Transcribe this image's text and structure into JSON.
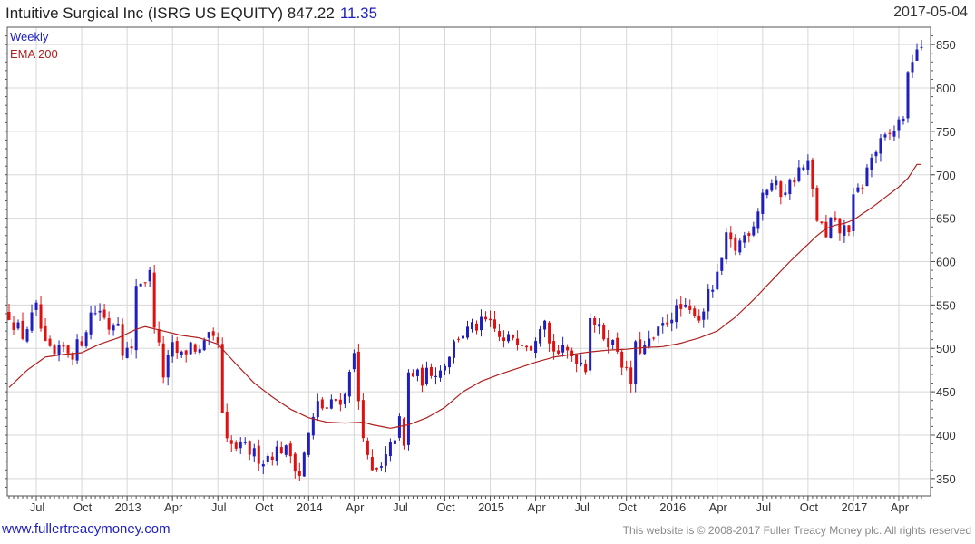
{
  "header": {
    "title": "Intuitive Surgical Inc (ISRG US EQUITY) 847.22",
    "change": "11.35",
    "date": "2017-05-04"
  },
  "footer": {
    "left": "www.fullertreacymoney.com",
    "right": "This website is © 2008-2017 Fuller Treacy Money plc. All rights reserved"
  },
  "colors": {
    "up": "#1f1fbf",
    "down": "#e01010",
    "ema": "#b02020",
    "grid": "#d8d8d8",
    "axis": "#555555"
  },
  "chart_data": {
    "type": "candlestick",
    "legend": [
      "Weekly",
      "EMA 200"
    ],
    "ylim": [
      330,
      870
    ],
    "yticks": [
      350,
      400,
      450,
      500,
      550,
      600,
      650,
      700,
      750,
      800,
      850
    ],
    "xlim": [
      0,
      201
    ],
    "xticks": [
      {
        "label": "Jul",
        "x": 6
      },
      {
        "label": "Oct",
        "x": 16
      },
      {
        "label": "2013",
        "x": 26
      },
      {
        "label": "Apr",
        "x": 36
      },
      {
        "label": "Jul",
        "x": 46
      },
      {
        "label": "Oct",
        "x": 56
      },
      {
        "label": "2014",
        "x": 66
      },
      {
        "label": "Apr",
        "x": 76
      },
      {
        "label": "Jul",
        "x": 86
      },
      {
        "label": "Oct",
        "x": 96
      },
      {
        "label": "2015",
        "x": 106
      },
      {
        "label": "Apr",
        "x": 116
      },
      {
        "label": "Jul",
        "x": 126
      },
      {
        "label": "Oct",
        "x": 136
      },
      {
        "label": "2016",
        "x": 146
      },
      {
        "label": "Apr",
        "x": 156
      },
      {
        "label": "Jul",
        "x": 166
      },
      {
        "label": "Oct",
        "x": 176
      },
      {
        "label": "2017",
        "x": 186
      },
      {
        "label": "Apr",
        "x": 196
      }
    ],
    "price_path": [
      [
        0,
        540
      ],
      [
        1,
        530
      ],
      [
        3,
        515
      ],
      [
        6,
        545
      ],
      [
        8,
        500
      ],
      [
        10,
        490
      ],
      [
        12,
        500
      ],
      [
        14,
        495
      ],
      [
        16,
        510
      ],
      [
        18,
        540
      ],
      [
        20,
        545
      ],
      [
        22,
        525
      ],
      [
        24,
        535
      ],
      [
        25,
        500
      ],
      [
        27,
        495
      ],
      [
        28,
        575
      ],
      [
        30,
        580
      ],
      [
        31,
        585
      ],
      [
        32,
        530
      ],
      [
        34,
        470
      ],
      [
        36,
        500
      ],
      [
        38,
        490
      ],
      [
        40,
        505
      ],
      [
        42,
        495
      ],
      [
        44,
        510
      ],
      [
        46,
        505
      ],
      [
        47,
        420
      ],
      [
        48,
        390
      ],
      [
        50,
        385
      ],
      [
        52,
        385
      ],
      [
        54,
        378
      ],
      [
        56,
        372
      ],
      [
        58,
        380
      ],
      [
        60,
        385
      ],
      [
        62,
        378
      ],
      [
        64,
        355
      ],
      [
        66,
        400
      ],
      [
        68,
        435
      ],
      [
        70,
        430
      ],
      [
        72,
        440
      ],
      [
        74,
        445
      ],
      [
        75,
        480
      ],
      [
        76,
        490
      ],
      [
        77,
        440
      ],
      [
        79,
        370
      ],
      [
        80,
        355
      ],
      [
        82,
        360
      ],
      [
        84,
        385
      ],
      [
        86,
        415
      ],
      [
        87,
        385
      ],
      [
        88,
        470
      ],
      [
        89,
        470
      ],
      [
        91,
        465
      ],
      [
        93,
        475
      ],
      [
        95,
        475
      ],
      [
        97,
        495
      ],
      [
        99,
        515
      ],
      [
        101,
        520
      ],
      [
        103,
        525
      ],
      [
        105,
        530
      ],
      [
        107,
        520
      ],
      [
        109,
        505
      ],
      [
        111,
        515
      ],
      [
        113,
        510
      ],
      [
        115,
        505
      ],
      [
        117,
        530
      ],
      [
        118,
        540
      ],
      [
        119,
        505
      ],
      [
        121,
        495
      ],
      [
        123,
        495
      ],
      [
        125,
        490
      ],
      [
        127,
        480
      ],
      [
        128,
        540
      ],
      [
        130,
        520
      ],
      [
        132,
        510
      ],
      [
        134,
        500
      ],
      [
        136,
        470
      ],
      [
        137,
        460
      ],
      [
        138,
        500
      ],
      [
        140,
        500
      ],
      [
        142,
        510
      ],
      [
        144,
        525
      ],
      [
        146,
        540
      ],
      [
        148,
        545
      ],
      [
        150,
        540
      ],
      [
        151,
        545
      ],
      [
        152,
        535
      ],
      [
        154,
        560
      ],
      [
        156,
        580
      ],
      [
        158,
        625
      ],
      [
        160,
        615
      ],
      [
        162,
        630
      ],
      [
        164,
        645
      ],
      [
        166,
        680
      ],
      [
        168,
        690
      ],
      [
        170,
        680
      ],
      [
        172,
        690
      ],
      [
        174,
        705
      ],
      [
        176,
        710
      ],
      [
        177,
        680
      ],
      [
        178,
        650
      ],
      [
        179,
        640
      ],
      [
        180,
        625
      ],
      [
        181,
        645
      ],
      [
        183,
        635
      ],
      [
        185,
        640
      ],
      [
        186,
        670
      ],
      [
        188,
        690
      ],
      [
        190,
        720
      ],
      [
        192,
        735
      ],
      [
        194,
        745
      ],
      [
        196,
        760
      ],
      [
        197,
        770
      ],
      [
        198,
        810
      ],
      [
        199,
        835
      ],
      [
        200,
        847.22
      ]
    ],
    "ema_path": [
      [
        0,
        455
      ],
      [
        4,
        475
      ],
      [
        8,
        490
      ],
      [
        12,
        493
      ],
      [
        16,
        495
      ],
      [
        20,
        505
      ],
      [
        24,
        512
      ],
      [
        28,
        522
      ],
      [
        30,
        525
      ],
      [
        34,
        520
      ],
      [
        38,
        515
      ],
      [
        42,
        512
      ],
      [
        46,
        505
      ],
      [
        50,
        482
      ],
      [
        54,
        460
      ],
      [
        58,
        444
      ],
      [
        62,
        430
      ],
      [
        66,
        420
      ],
      [
        70,
        415
      ],
      [
        74,
        414
      ],
      [
        78,
        415
      ],
      [
        80,
        412
      ],
      [
        84,
        408
      ],
      [
        88,
        412
      ],
      [
        92,
        420
      ],
      [
        96,
        432
      ],
      [
        100,
        450
      ],
      [
        104,
        462
      ],
      [
        108,
        470
      ],
      [
        112,
        477
      ],
      [
        116,
        484
      ],
      [
        120,
        490
      ],
      [
        124,
        493
      ],
      [
        128,
        496
      ],
      [
        132,
        498
      ],
      [
        136,
        499
      ],
      [
        140,
        501
      ],
      [
        144,
        502
      ],
      [
        148,
        506
      ],
      [
        152,
        512
      ],
      [
        156,
        520
      ],
      [
        160,
        536
      ],
      [
        164,
        556
      ],
      [
        168,
        578
      ],
      [
        172,
        600
      ],
      [
        176,
        620
      ],
      [
        178,
        630
      ],
      [
        180,
        638
      ],
      [
        182,
        642
      ],
      [
        184,
        644
      ],
      [
        186,
        648
      ],
      [
        190,
        662
      ],
      [
        194,
        678
      ],
      [
        196,
        686
      ],
      [
        198,
        696
      ],
      [
        200,
        712
      ]
    ]
  }
}
